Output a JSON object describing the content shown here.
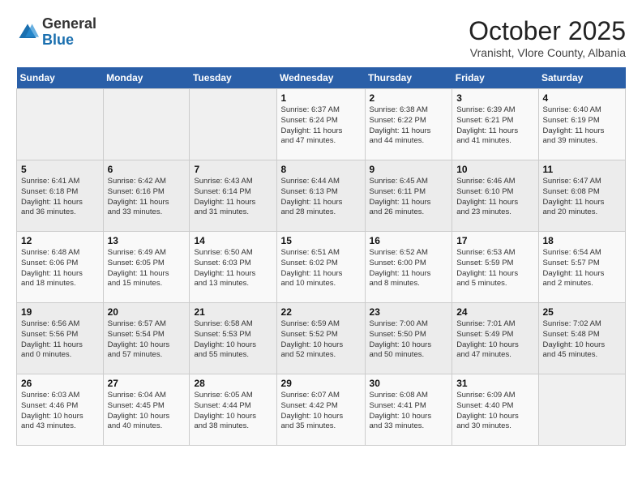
{
  "logo": {
    "general": "General",
    "blue": "Blue"
  },
  "title": "October 2025",
  "subtitle": "Vranisht, Vlore County, Albania",
  "days_header": [
    "Sunday",
    "Monday",
    "Tuesday",
    "Wednesday",
    "Thursday",
    "Friday",
    "Saturday"
  ],
  "weeks": [
    [
      {
        "day": "",
        "info": ""
      },
      {
        "day": "",
        "info": ""
      },
      {
        "day": "",
        "info": ""
      },
      {
        "day": "1",
        "info": "Sunrise: 6:37 AM\nSunset: 6:24 PM\nDaylight: 11 hours\nand 47 minutes."
      },
      {
        "day": "2",
        "info": "Sunrise: 6:38 AM\nSunset: 6:22 PM\nDaylight: 11 hours\nand 44 minutes."
      },
      {
        "day": "3",
        "info": "Sunrise: 6:39 AM\nSunset: 6:21 PM\nDaylight: 11 hours\nand 41 minutes."
      },
      {
        "day": "4",
        "info": "Sunrise: 6:40 AM\nSunset: 6:19 PM\nDaylight: 11 hours\nand 39 minutes."
      }
    ],
    [
      {
        "day": "5",
        "info": "Sunrise: 6:41 AM\nSunset: 6:18 PM\nDaylight: 11 hours\nand 36 minutes."
      },
      {
        "day": "6",
        "info": "Sunrise: 6:42 AM\nSunset: 6:16 PM\nDaylight: 11 hours\nand 33 minutes."
      },
      {
        "day": "7",
        "info": "Sunrise: 6:43 AM\nSunset: 6:14 PM\nDaylight: 11 hours\nand 31 minutes."
      },
      {
        "day": "8",
        "info": "Sunrise: 6:44 AM\nSunset: 6:13 PM\nDaylight: 11 hours\nand 28 minutes."
      },
      {
        "day": "9",
        "info": "Sunrise: 6:45 AM\nSunset: 6:11 PM\nDaylight: 11 hours\nand 26 minutes."
      },
      {
        "day": "10",
        "info": "Sunrise: 6:46 AM\nSunset: 6:10 PM\nDaylight: 11 hours\nand 23 minutes."
      },
      {
        "day": "11",
        "info": "Sunrise: 6:47 AM\nSunset: 6:08 PM\nDaylight: 11 hours\nand 20 minutes."
      }
    ],
    [
      {
        "day": "12",
        "info": "Sunrise: 6:48 AM\nSunset: 6:06 PM\nDaylight: 11 hours\nand 18 minutes."
      },
      {
        "day": "13",
        "info": "Sunrise: 6:49 AM\nSunset: 6:05 PM\nDaylight: 11 hours\nand 15 minutes."
      },
      {
        "day": "14",
        "info": "Sunrise: 6:50 AM\nSunset: 6:03 PM\nDaylight: 11 hours\nand 13 minutes."
      },
      {
        "day": "15",
        "info": "Sunrise: 6:51 AM\nSunset: 6:02 PM\nDaylight: 11 hours\nand 10 minutes."
      },
      {
        "day": "16",
        "info": "Sunrise: 6:52 AM\nSunset: 6:00 PM\nDaylight: 11 hours\nand 8 minutes."
      },
      {
        "day": "17",
        "info": "Sunrise: 6:53 AM\nSunset: 5:59 PM\nDaylight: 11 hours\nand 5 minutes."
      },
      {
        "day": "18",
        "info": "Sunrise: 6:54 AM\nSunset: 5:57 PM\nDaylight: 11 hours\nand 2 minutes."
      }
    ],
    [
      {
        "day": "19",
        "info": "Sunrise: 6:56 AM\nSunset: 5:56 PM\nDaylight: 11 hours\nand 0 minutes."
      },
      {
        "day": "20",
        "info": "Sunrise: 6:57 AM\nSunset: 5:54 PM\nDaylight: 10 hours\nand 57 minutes."
      },
      {
        "day": "21",
        "info": "Sunrise: 6:58 AM\nSunset: 5:53 PM\nDaylight: 10 hours\nand 55 minutes."
      },
      {
        "day": "22",
        "info": "Sunrise: 6:59 AM\nSunset: 5:52 PM\nDaylight: 10 hours\nand 52 minutes."
      },
      {
        "day": "23",
        "info": "Sunrise: 7:00 AM\nSunset: 5:50 PM\nDaylight: 10 hours\nand 50 minutes."
      },
      {
        "day": "24",
        "info": "Sunrise: 7:01 AM\nSunset: 5:49 PM\nDaylight: 10 hours\nand 47 minutes."
      },
      {
        "day": "25",
        "info": "Sunrise: 7:02 AM\nSunset: 5:48 PM\nDaylight: 10 hours\nand 45 minutes."
      }
    ],
    [
      {
        "day": "26",
        "info": "Sunrise: 6:03 AM\nSunset: 4:46 PM\nDaylight: 10 hours\nand 43 minutes."
      },
      {
        "day": "27",
        "info": "Sunrise: 6:04 AM\nSunset: 4:45 PM\nDaylight: 10 hours\nand 40 minutes."
      },
      {
        "day": "28",
        "info": "Sunrise: 6:05 AM\nSunset: 4:44 PM\nDaylight: 10 hours\nand 38 minutes."
      },
      {
        "day": "29",
        "info": "Sunrise: 6:07 AM\nSunset: 4:42 PM\nDaylight: 10 hours\nand 35 minutes."
      },
      {
        "day": "30",
        "info": "Sunrise: 6:08 AM\nSunset: 4:41 PM\nDaylight: 10 hours\nand 33 minutes."
      },
      {
        "day": "31",
        "info": "Sunrise: 6:09 AM\nSunset: 4:40 PM\nDaylight: 10 hours\nand 30 minutes."
      },
      {
        "day": "",
        "info": ""
      }
    ]
  ]
}
